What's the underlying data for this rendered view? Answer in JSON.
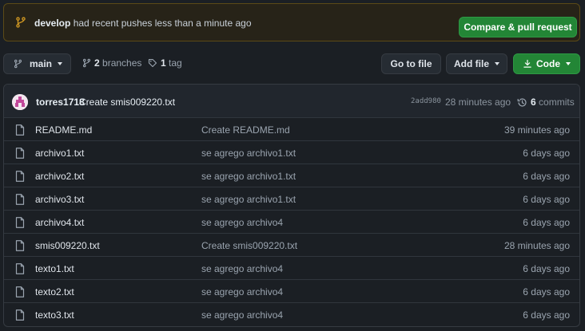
{
  "banner": {
    "branch": "develop",
    "message": " had recent pushes less than a minute ago",
    "compare_label": "Compare & pull request"
  },
  "toolbar": {
    "branch_label": "main",
    "branches_count": "2",
    "branches_label": " branches",
    "tags_count": "1",
    "tags_label": " tag",
    "goto_label": "Go to file",
    "addfile_label": "Add file",
    "code_label": "Code"
  },
  "commit": {
    "author": "torres1718",
    "message": "Create smis009220.txt",
    "hash": "2add980",
    "time": "28 minutes ago",
    "commits_count": "6",
    "commits_label": " commits"
  },
  "files": [
    {
      "name": "README.md",
      "message": "Create README.md",
      "time": "39 minutes ago"
    },
    {
      "name": "archivo1.txt",
      "message": "se agrego archivo1.txt",
      "time": "6 days ago"
    },
    {
      "name": "archivo2.txt",
      "message": "se agrego archivo1.txt",
      "time": "6 days ago"
    },
    {
      "name": "archivo3.txt",
      "message": "se agrego archivo1.txt",
      "time": "6 days ago"
    },
    {
      "name": "archivo4.txt",
      "message": "se agrego archivo4",
      "time": "6 days ago"
    },
    {
      "name": "smis009220.txt",
      "message": "Create smis009220.txt",
      "time": "28 minutes ago"
    },
    {
      "name": "texto1.txt",
      "message": "se agrego archivo4",
      "time": "6 days ago"
    },
    {
      "name": "texto2.txt",
      "message": "se agrego archivo4",
      "time": "6 days ago"
    },
    {
      "name": "texto3.txt",
      "message": "se agrego archivo4",
      "time": "6 days ago"
    }
  ],
  "colors": {
    "banner_bg": "#272318",
    "banner_icon": "#d29922",
    "green": "#238636",
    "link": "#dfe4ea"
  }
}
